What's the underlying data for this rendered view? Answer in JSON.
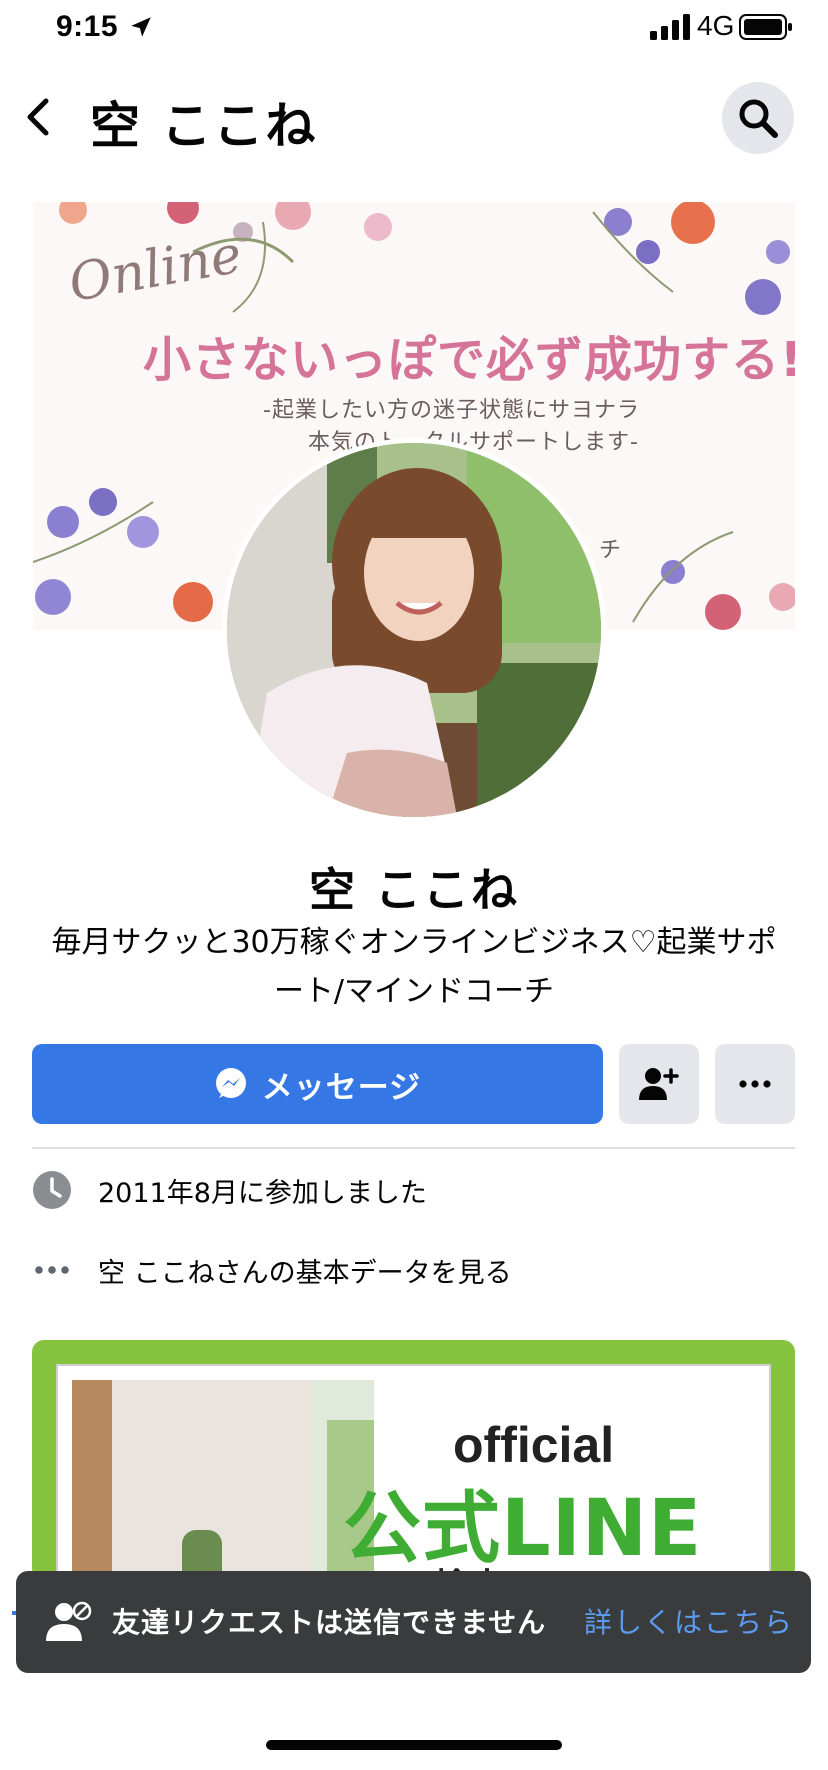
{
  "status_bar": {
    "time": "9:15",
    "network": "4G",
    "icons": [
      "location-arrow-icon",
      "signal-icon",
      "battery-icon"
    ]
  },
  "nav": {
    "back_icon": "chevron-left-icon",
    "title": "空 ここね",
    "search_icon": "search-icon"
  },
  "cover": {
    "script_text": "Online",
    "headline": "小さないっぽで必ず成功する!",
    "subtitle_line1": "-起業したい方の迷子状態にサヨナラ",
    "subtitle_line2": "本気のトータルサポートします-",
    "trailing_text": "チ"
  },
  "profile": {
    "name": "空 ここね",
    "bio": "毎月サクッと30万稼ぐオンラインビジネス♡起業サポート/マインドコーチ"
  },
  "actions": {
    "message_label": "メッセージ",
    "message_icon": "messenger-icon",
    "add_friend_icon": "add-friend-icon",
    "more_icon": "more-horizontal-icon"
  },
  "info": {
    "joined": "2011年8月に参加しました",
    "joined_icon": "clock-icon",
    "about": "空 ここねさんの基本データを見る",
    "about_icon": "more-horizontal-icon"
  },
  "featured": {
    "official": "official",
    "line_title": "公式LINE",
    "search_text": "検索→@kokone"
  },
  "toast": {
    "icon": "friend-request-blocked-icon",
    "message": "友達リクエストは送信できません",
    "link": "詳しくはこちら"
  },
  "colors": {
    "primary": "#3578e5",
    "toast_bg": "#3a3b3c",
    "link": "#5b9cf0",
    "line_green": "#3fad34",
    "feature_border": "#86c440",
    "headline_pink": "#d57498",
    "secondary_btn": "#e4e6eb"
  }
}
